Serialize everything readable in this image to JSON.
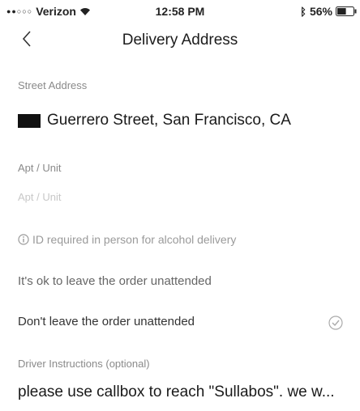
{
  "status_bar": {
    "signal": "●●○○○",
    "carrier": "Verizon",
    "time": "12:58 PM",
    "battery_percent": "56%",
    "battery_level": 0.56
  },
  "nav": {
    "title": "Delivery Address"
  },
  "street": {
    "label": "Street Address",
    "value": "Guerrero Street, San Francisco, CA"
  },
  "apt": {
    "label": "Apt / Unit",
    "placeholder": "Apt / Unit"
  },
  "alcohol_notice": {
    "text": "ID required in person for alcohol delivery"
  },
  "options": [
    {
      "label": "It's ok to leave the order unattended",
      "selected": false
    },
    {
      "label": "Don't leave the order unattended",
      "selected": true
    }
  ],
  "instructions": {
    "label": "Driver Instructions (optional)",
    "value": "please use callbox to reach \"Sullabos\". we w..."
  }
}
